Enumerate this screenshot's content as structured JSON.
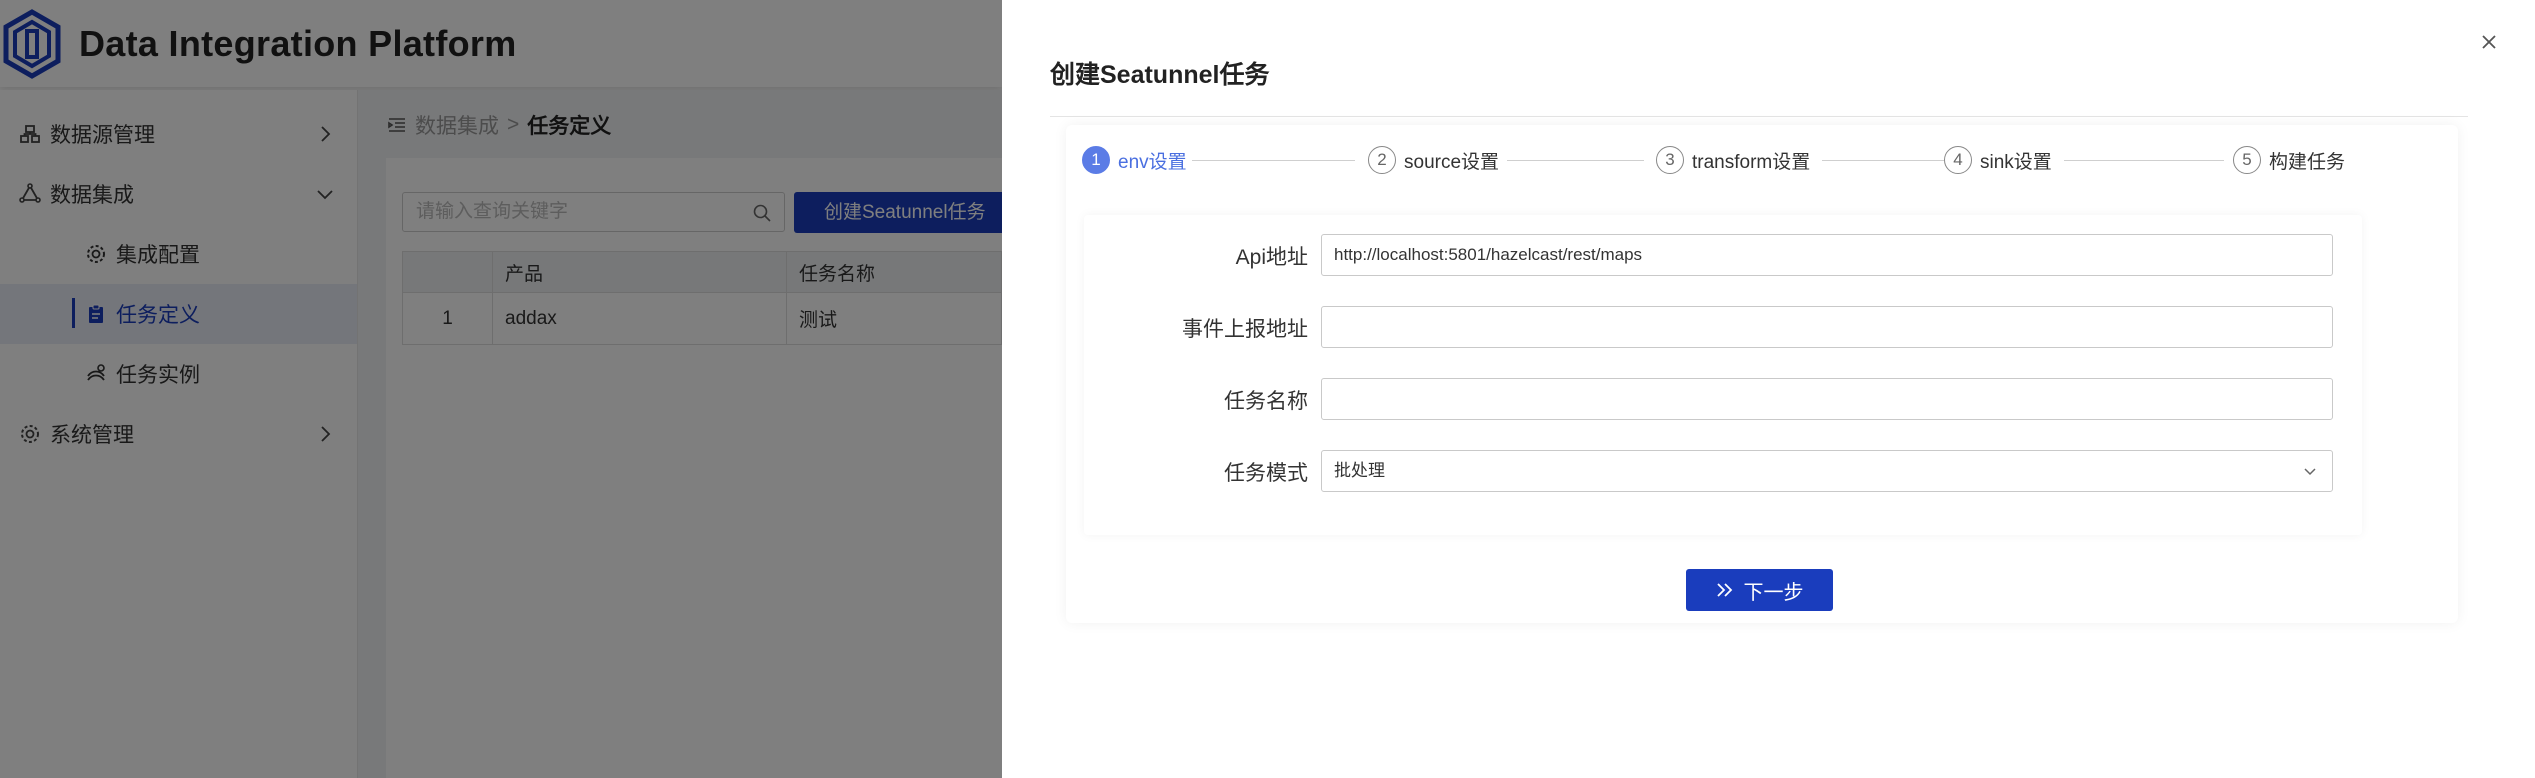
{
  "app": {
    "title": "Data Integration Platform"
  },
  "sidebar": {
    "items": [
      {
        "label": "数据源管理"
      },
      {
        "label": "数据集成"
      },
      {
        "label": "集成配置"
      },
      {
        "label": "任务定义"
      },
      {
        "label": "任务实例"
      },
      {
        "label": "系统管理"
      }
    ]
  },
  "breadcrumb": {
    "parent": "数据集成",
    "separator": ">",
    "current": "任务定义"
  },
  "toolbar": {
    "search_placeholder": "请输入查询关键字",
    "create_label": "创建Seatunnel任务"
  },
  "table": {
    "headers": [
      "",
      "产品",
      "任务名称"
    ],
    "rows": [
      {
        "index": "1",
        "product": "addax",
        "name": "测试"
      }
    ]
  },
  "drawer": {
    "title": "创建Seatunnel任务",
    "steps": [
      {
        "num": "1",
        "label": "env设置"
      },
      {
        "num": "2",
        "label": "source设置"
      },
      {
        "num": "3",
        "label": "transform设置"
      },
      {
        "num": "4",
        "label": "sink设置"
      },
      {
        "num": "5",
        "label": "构建任务"
      }
    ],
    "active_step": 1,
    "form": {
      "api_label": "Api地址",
      "api_value": "http://localhost:5801/hazelcast/rest/maps",
      "event_label": "事件上报地址",
      "event_value": "",
      "task_name_label": "任务名称",
      "task_name_value": "",
      "mode_label": "任务模式",
      "mode_value": "批处理"
    },
    "next_label": "下一步"
  },
  "colors": {
    "primary": "#1a3dbd",
    "step_active": "#5b7ce6"
  }
}
